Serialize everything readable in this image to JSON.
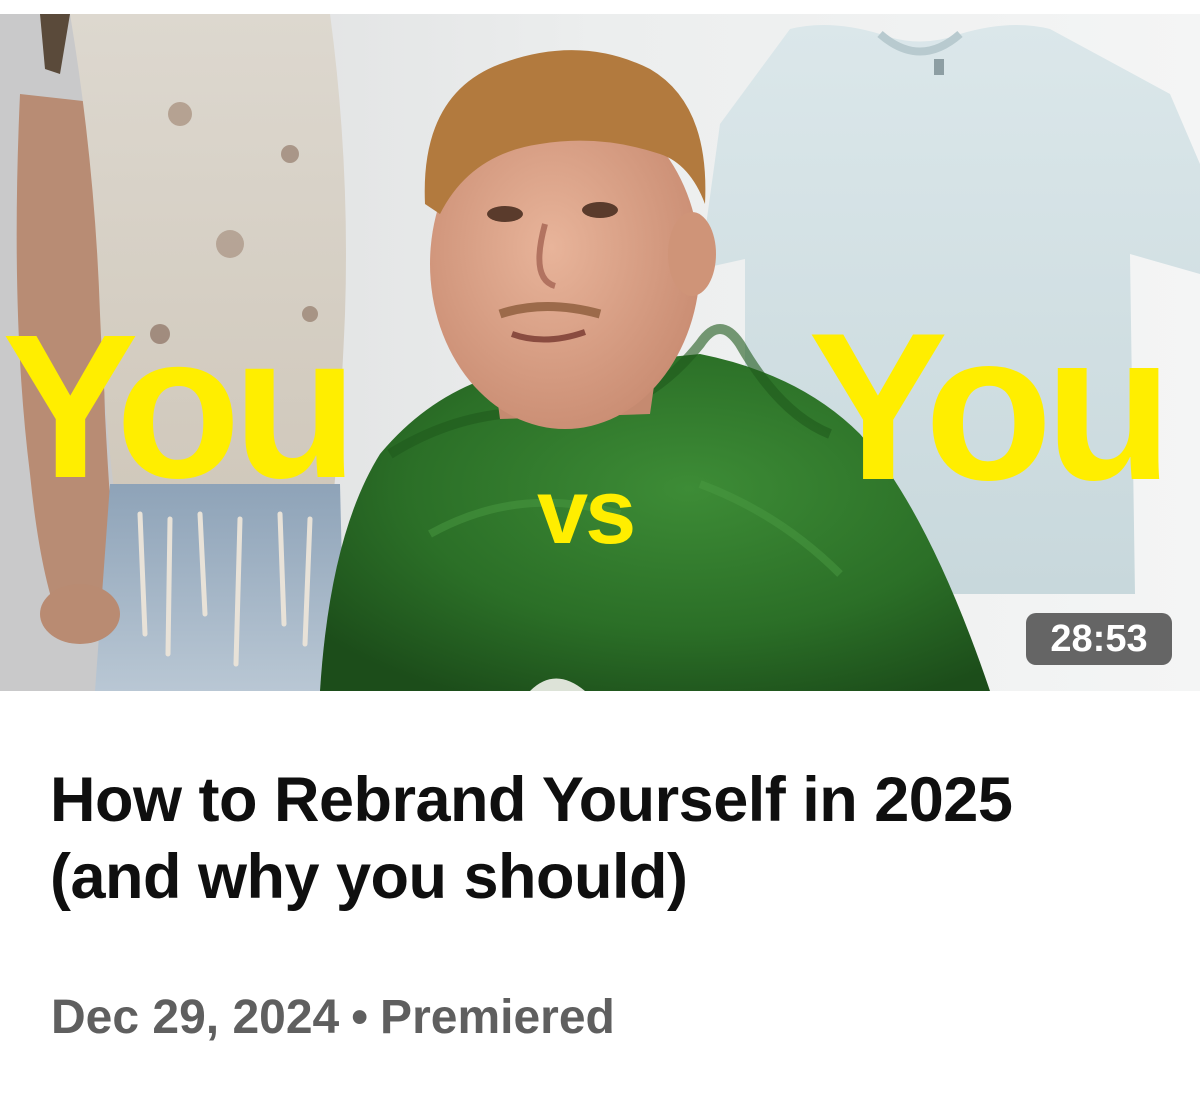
{
  "video": {
    "thumbnail": {
      "text_left": "You",
      "text_vs": "vs",
      "text_right": "You",
      "accent_color": "#ffee00",
      "sweater_color": "#2f7a2c"
    },
    "duration": "28:53",
    "title": "How to Rebrand Yourself in 2025 (and why you should)",
    "date": "Dec 29, 2024",
    "separator": "•",
    "status": "Premiered"
  }
}
